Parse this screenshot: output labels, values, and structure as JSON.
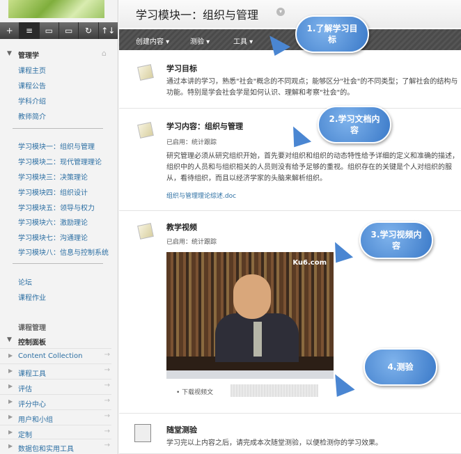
{
  "toolbar": {
    "buttons": [
      "+",
      "≡",
      "▭",
      "▭",
      "↻",
      "↑↓"
    ]
  },
  "nav": {
    "heading": "管理学",
    "links": [
      "课程主页",
      "课程公告",
      "学科介绍",
      "教师简介"
    ],
    "modules": [
      "学习模块一：组织与管理",
      "学习模块二：现代管理理论",
      "学习模块三：决策理论",
      "学习模块四：组织设计",
      "学习模块五：领导与权力",
      "学习模块六：激励理论",
      "学习模块七：沟通理论",
      "学习模块八：信息与控制系统"
    ],
    "extra": [
      "论坛",
      "课程作业"
    ],
    "course_mgmt": "课程管理",
    "control_panel": "控制面板",
    "cp_items": [
      "Content Collection",
      "课程工具",
      "评估",
      "评分中心",
      "用户和小组",
      "定制",
      "数据包和实用工具"
    ]
  },
  "main": {
    "title": "学习模块一：组织与管理",
    "menu": [
      "创建内容",
      "测验",
      "工具"
    ],
    "items": [
      {
        "title": "学习目标",
        "text": "通过本讲的学习，熟悉\"社会\"概念的不同观点；能够区分\"社会\"的不同类型；了解社会的结构与功能。特别是学会社会学是如何认识、理解和考察\"社会\"的。"
      },
      {
        "title": "学习内容：组织与管理",
        "meta": "已启用：统计跟踪",
        "text": "研究管理必须从研究组织开始，首先要对组织和组织的动态特性给予详细的定义和准确的描述，组织中的人员和与组织相关的人员则没有给予足够的重视。组织存在的关键是个人对组织的服从，看待组织，而且以经济学家的头脑来解析组织。",
        "link": "组织与管理理论综述.doc"
      },
      {
        "title": "教学视频",
        "meta": "已启用：统计跟踪",
        "download": "下载视频文"
      },
      {
        "title": "随堂测验",
        "text": "学习完以上内容之后，请完成本次随堂测验，以便检测你的学习效果。"
      }
    ],
    "video_logo": "Ku6.com"
  },
  "callouts": [
    "1.了解学习目标",
    "2.学习文档内容",
    "3.学习视频内容",
    "4.测验"
  ]
}
